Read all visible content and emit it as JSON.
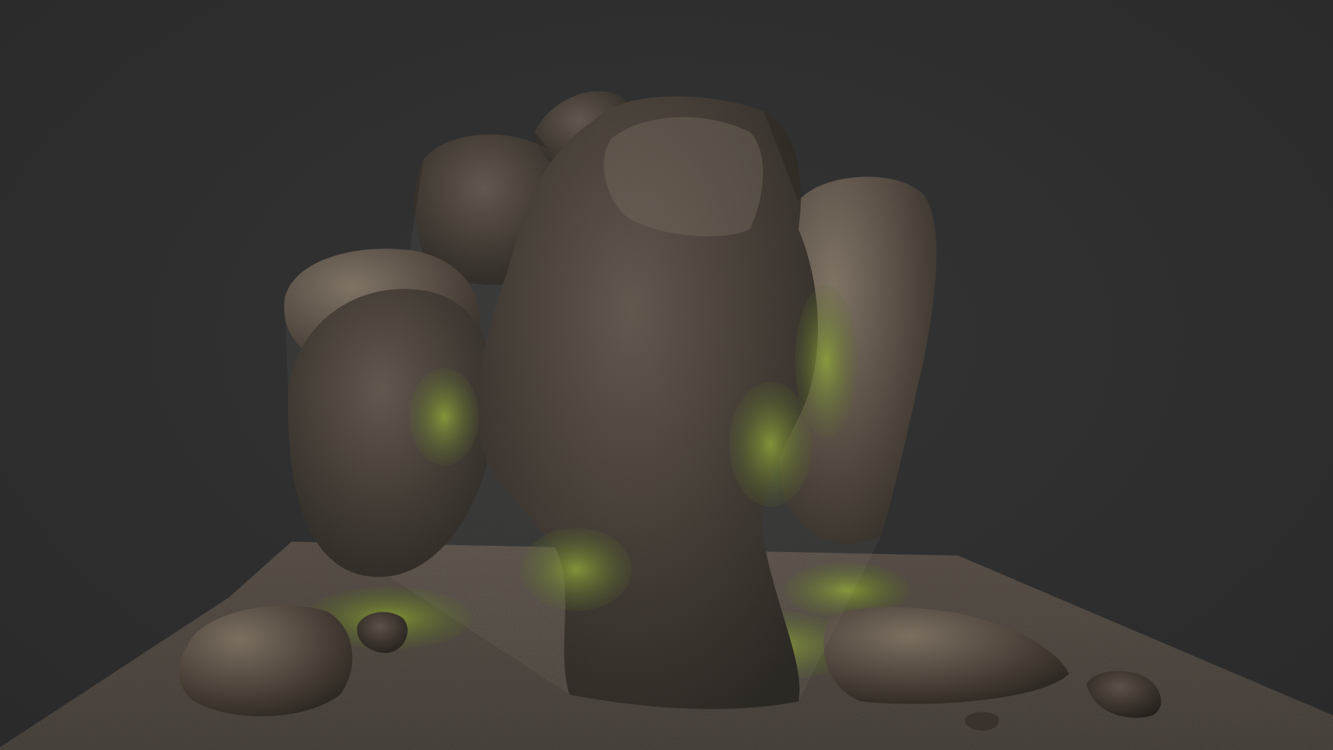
{
  "scene": {
    "background_color": "#2f2f2f",
    "subject": "3d-rock-formation-model",
    "materials": {
      "rock_dark": "#2a2622",
      "rock_mid": "#4a423a",
      "rock_light": "#7a6e5e",
      "moss": "#6f7a2a",
      "moss_bright": "#8a9a30",
      "ground": "#5a5048"
    }
  }
}
